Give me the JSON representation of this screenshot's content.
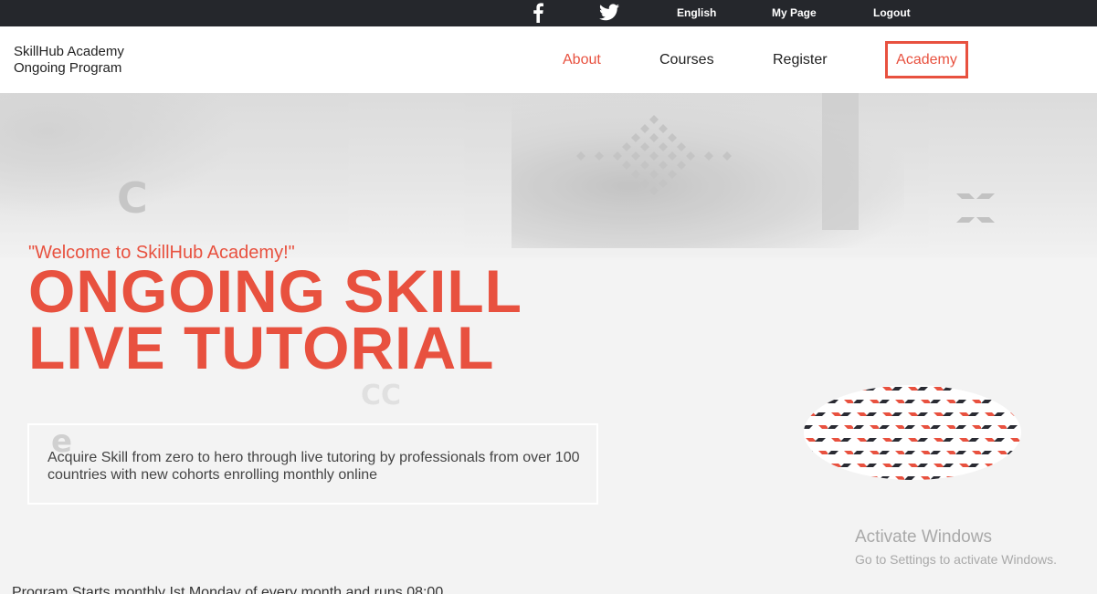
{
  "topbar": {
    "icons": {
      "facebook": "facebook-icon",
      "twitter": "twitter-icon"
    },
    "links": {
      "english": "English",
      "my_page": "My Page",
      "logout": "Logout"
    }
  },
  "header": {
    "brand_line1": "SkillHub Academy",
    "brand_line2": "Ongoing Program",
    "nav": {
      "about": "About",
      "courses": "Courses",
      "register": "Register",
      "academy": "Academy"
    }
  },
  "hero": {
    "welcome": "\"Welcome to SkillHub Academy!\"",
    "headline_line1": "ONGOING SKILL",
    "headline_line2": "LIVE TUTORIAL",
    "description": "Acquire Skill from zero to hero through live tutoring by professionals from over 100 countries with new cohorts enrolling monthly online",
    "program_note": "Program Starts monthly Ist Monday of every month and runs 08:00"
  },
  "watermark": {
    "title": "Activate Windows",
    "subtitle": "Go to Settings to activate Windows."
  },
  "colors": {
    "accent": "#e8513f",
    "topbar_bg": "#25272c",
    "dark_diamond": "#2a2b33"
  }
}
